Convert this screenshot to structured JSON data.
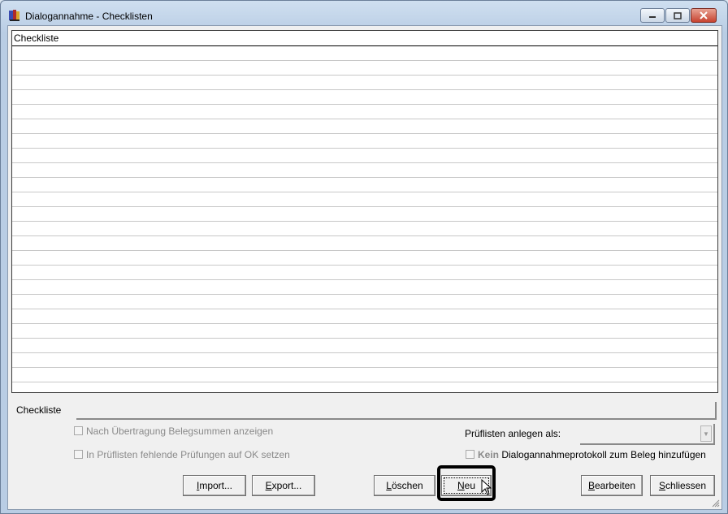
{
  "window": {
    "title": "Dialogannahme - Checklisten"
  },
  "grid": {
    "column_header": "Checkliste",
    "row_count": 23
  },
  "form": {
    "checkliste_label": "Checkliste",
    "checkliste_value": "",
    "option1_label": "Nach Übertragung Belegsummen anzeigen",
    "option2_label": "In Prüflisten fehlende Prüfungen auf OK setzen",
    "pruef_label": "Prüflisten anlegen als:",
    "pruef_value": "",
    "kein_bold": "Kein",
    "kein_label": " Dialogannahmeprotokoll zum Beleg hinzufügen"
  },
  "buttons": {
    "import_first": "I",
    "import_rest": "mport...",
    "export_first": "E",
    "export_rest": "xport...",
    "loeschen_first": "L",
    "loeschen_rest": "öschen",
    "neu_first": "N",
    "neu_rest": "eu",
    "bearbeiten_first": "B",
    "bearbeiten_rest": "earbeiten",
    "schliessen_first": "S",
    "schliessen_rest": "chliessen"
  },
  "colors": {
    "highlight": "#000000",
    "close_button": "#c7422f"
  }
}
